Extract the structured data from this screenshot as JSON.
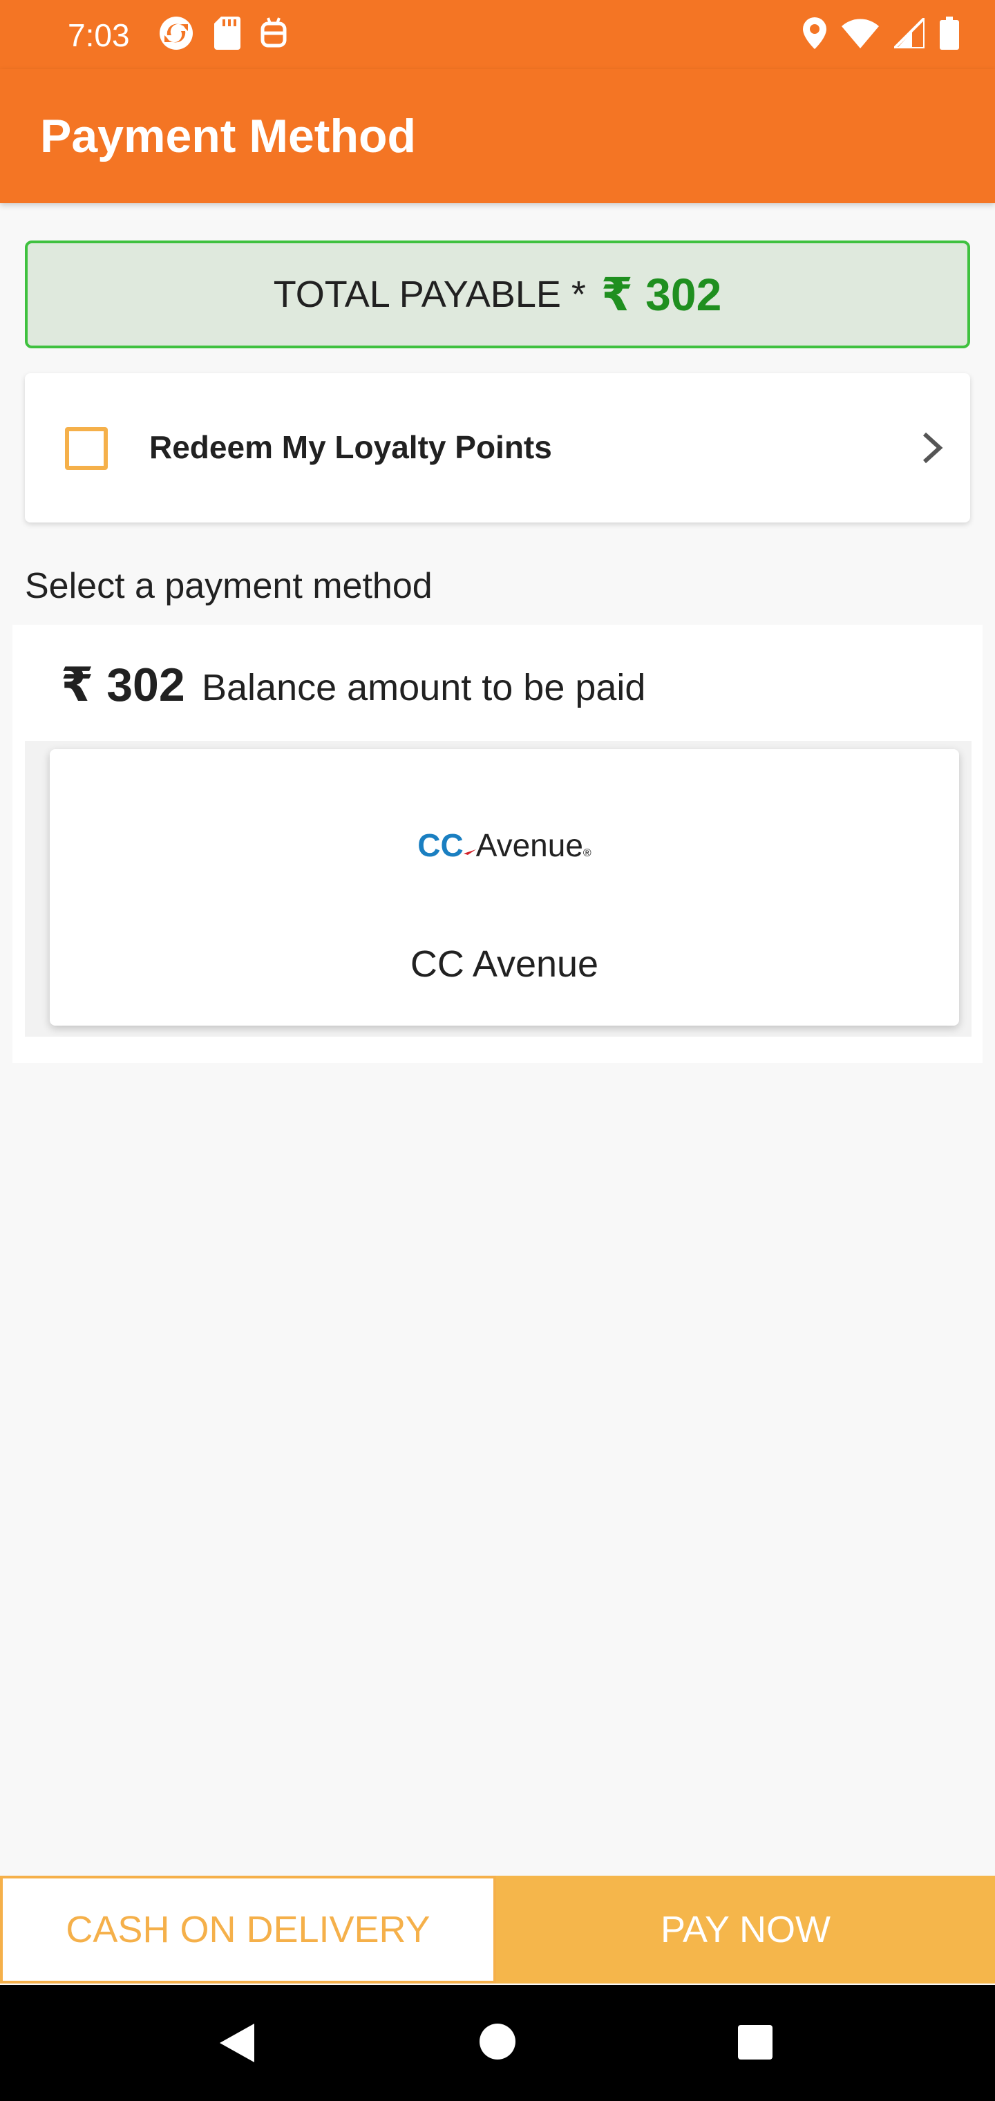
{
  "status_bar": {
    "time": "7:03",
    "left_icons": [
      "sync-icon",
      "sd-card-icon",
      "android-icon"
    ],
    "right_icons": [
      "location-icon",
      "wifi-icon",
      "signal-icon",
      "battery-icon"
    ]
  },
  "app_bar": {
    "title": "Payment Method",
    "background": "#f47524"
  },
  "total": {
    "label": "TOTAL PAYABLE *",
    "amount": "₹ 302",
    "amount_color": "#1f8f1f"
  },
  "loyalty": {
    "label": "Redeem My Loyalty Points",
    "checked": false
  },
  "select_heading": "Select a payment method",
  "balance": {
    "amount": "₹ 302",
    "label": "Balance amount to be paid"
  },
  "gateway": {
    "logo_cc": "CC",
    "logo_avenue": "Avenue",
    "logo_reg": "®",
    "name": "CC Avenue"
  },
  "actions": {
    "cod_label": "CASH ON DELIVERY",
    "pay_label": "PAY NOW",
    "accent": "#f5b04a"
  },
  "nav": {
    "icons": [
      "back-icon",
      "home-icon",
      "recent-apps-icon"
    ]
  }
}
